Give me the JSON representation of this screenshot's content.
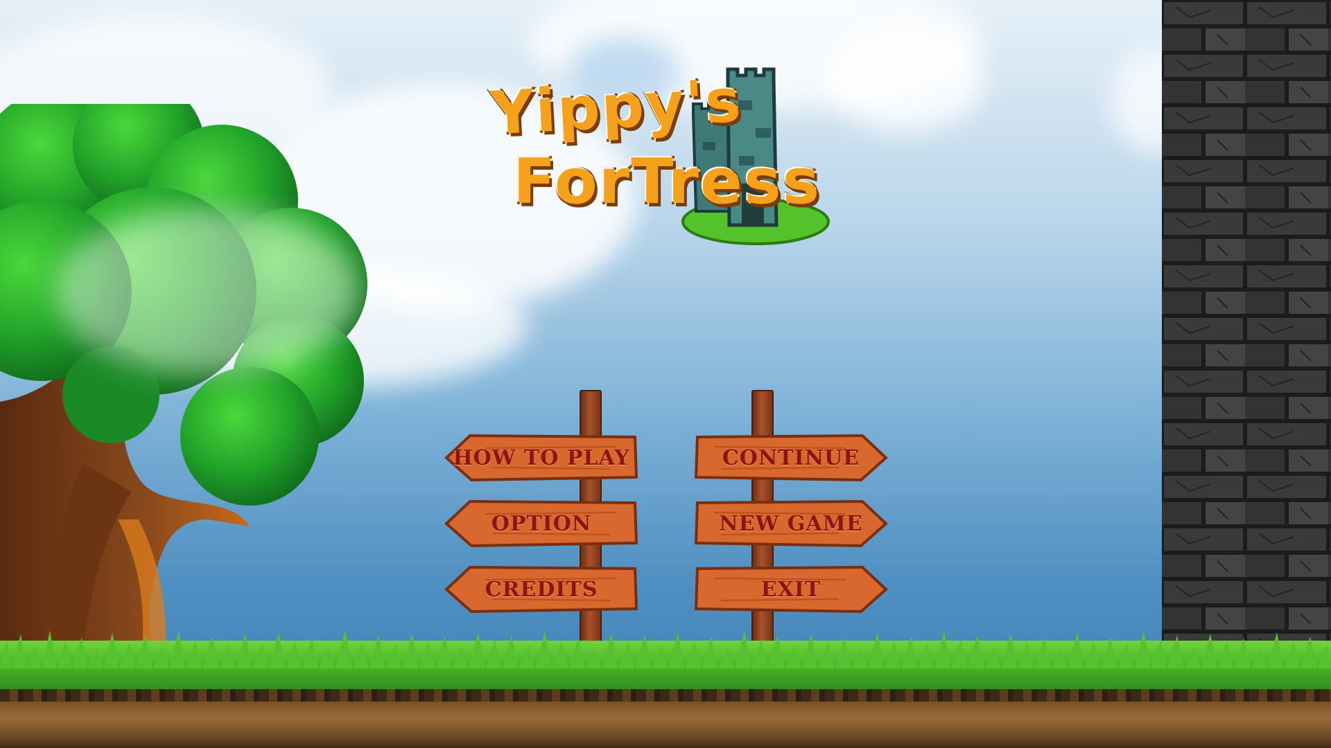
{
  "game": {
    "title_line1": "Yippy's",
    "title_line2": "ForTress"
  },
  "menu": {
    "left": [
      {
        "label": "HOW TO PLAY"
      },
      {
        "label": "OPTION"
      },
      {
        "label": "CREDITS"
      }
    ],
    "right": [
      {
        "label": "CONTINUE"
      },
      {
        "label": "NEW GAME"
      },
      {
        "label": "EXIT"
      }
    ]
  },
  "colors": {
    "sky_top": "#e6f0f8",
    "sky_bottom": "#3c7db2",
    "sign_wood": "#d9682e",
    "sign_text": "#8c1512",
    "title_orange": "#f6a11b",
    "grass": "#4cb72a",
    "wall_stone": "#2e2e2e"
  }
}
